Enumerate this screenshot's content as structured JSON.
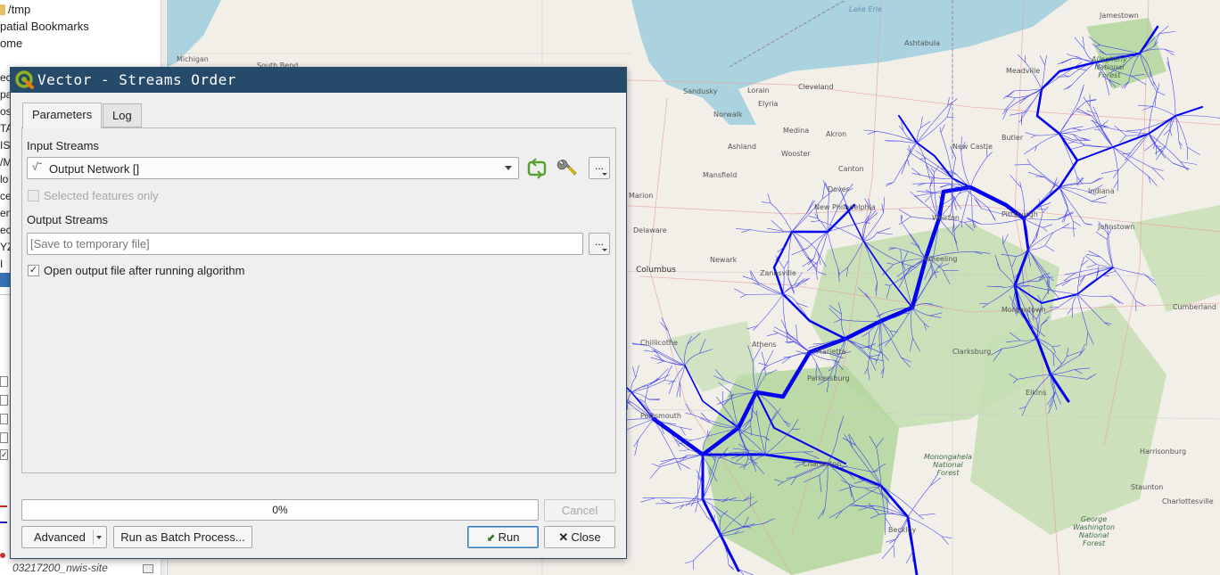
{
  "browser_panel": {
    "items": [
      {
        "icon": "folder-icon",
        "label": "/tmp"
      },
      {
        "icon": "bookmark-icon",
        "label": "patial Bookmarks"
      },
      {
        "icon": "home-icon",
        "label": "ome"
      }
    ],
    "clipped_labels": [
      "ec",
      "pa",
      "os",
      "TA",
      "IS",
      "/M",
      "lo",
      "ce",
      "en",
      "ec",
      "YZ",
      "I"
    ],
    "bottom_layer_label": "03217200_nwis-site"
  },
  "map": {
    "labels": {
      "lake_erie": "Lake Erie",
      "columbus": "Columbus",
      "cumberland": "Cumberland",
      "monongahela": "Monongahela\nNational\nForest",
      "george_washington": "George\nWashington\nNational\nForest",
      "allegheny": "Allegheny\nNational\nForest",
      "michigan": "Michigan",
      "south_bend": "South Bend",
      "jamestown": "Jamestown",
      "meadville": "Meadville",
      "new_castle": "New Castle",
      "pittsburgh": "Pittsburgh",
      "wheeling": "Wheeling",
      "morgantown": "Morgantown",
      "zanesville": "Zanesville",
      "marietta": "Marietta",
      "parkersburg": "Parkersburg",
      "chillicothe": "Chillicothe",
      "athens": "Athens",
      "charleston": "Charleston",
      "clarksburg": "Clarksburg",
      "elkins": "Elkins",
      "harrisonburg": "Harrisonburg",
      "staunton": "Staunton",
      "charlottesville": "Charlottesville",
      "johnstown": "Johnstown",
      "indiana": "Indiana",
      "beckley": "Beckley",
      "portsmouth": "Portsmouth",
      "mansfield": "Mansfield",
      "delaware": "Delaware",
      "marion": "Marion",
      "sandusky": "Sandusky",
      "lorain": "Lorain",
      "cleveland": "Cleveland",
      "ashtabula": "Ashtabula",
      "canton": "Canton",
      "new_philadelphia": "New Philadelphia",
      "newark": "Newark",
      "weirton": "Weirton",
      "butler": "Butler",
      "elyria": "Elyria",
      "medina": "Medina",
      "akron": "Akron",
      "norwalk": "Norwalk",
      "ashland": "Ashland",
      "wooster": "Wooster",
      "dover": "Dover"
    }
  },
  "dialog": {
    "title": "Vector - Streams Order",
    "tabs": [
      {
        "label": "Parameters",
        "active": true
      },
      {
        "label": "Log",
        "active": false
      }
    ],
    "input_streams": {
      "label": "Input Streams",
      "value": "Output Network []"
    },
    "selected_features_only": {
      "label": "Selected features only",
      "checked": false,
      "enabled": false
    },
    "output_streams": {
      "label": "Output Streams",
      "placeholder": "[Save to temporary file]"
    },
    "open_output": {
      "label": "Open output file after running algorithm",
      "checked": true
    },
    "progress": {
      "text": "0%",
      "value": 0
    },
    "buttons": {
      "cancel": "Cancel",
      "advanced": "Advanced",
      "batch": "Run as Batch Process...",
      "run": "Run",
      "close": "Close",
      "browse": "..."
    }
  },
  "colors": {
    "title_bar": "#264a6a",
    "stream": "#1a1aff",
    "water": "#aad3df",
    "forest": "#add19e"
  }
}
